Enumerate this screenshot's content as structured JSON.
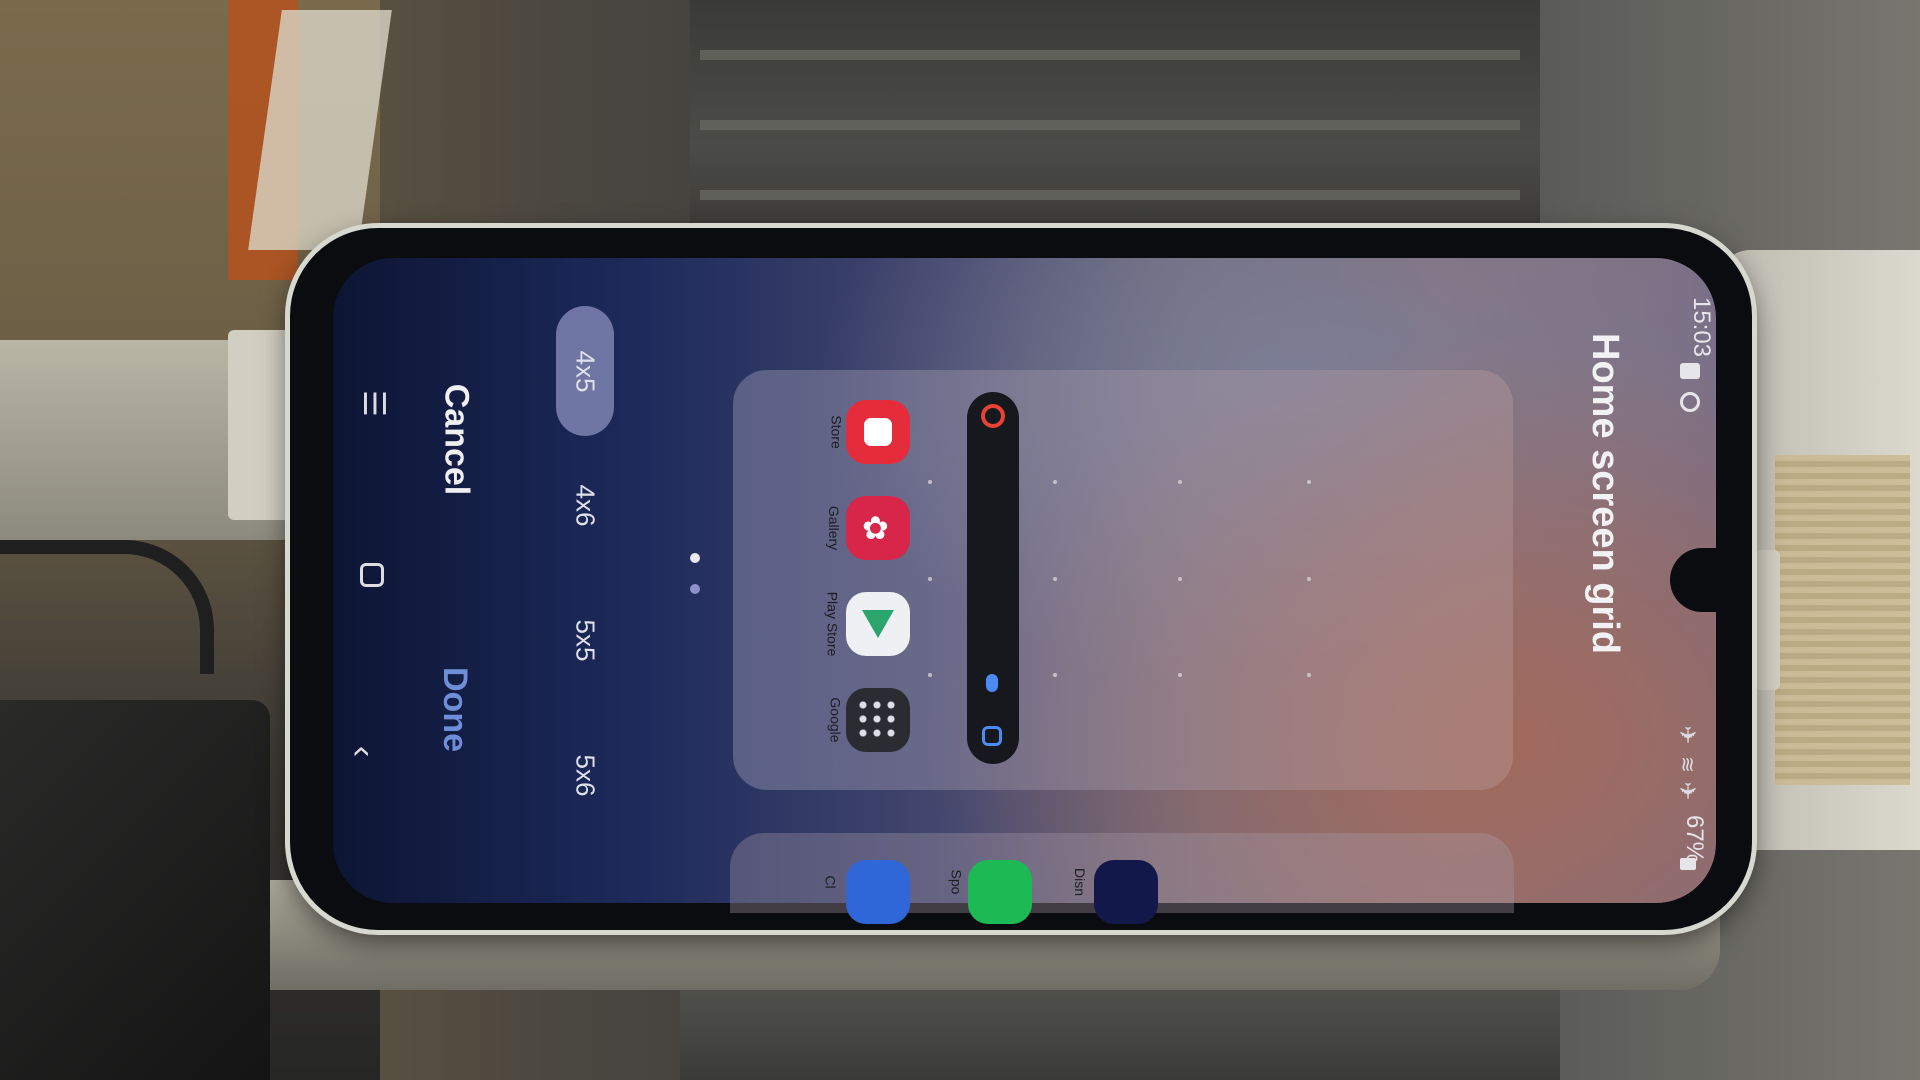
{
  "screen": {
    "title": "Home screen grid",
    "status_bar": {
      "time": "15:03",
      "battery": "67%"
    },
    "actions": {
      "cancel_label": "Cancel",
      "done_label": "Done"
    },
    "grid_options": [
      {
        "label": "4x5",
        "selected": true
      },
      {
        "label": "4x6",
        "selected": false
      },
      {
        "label": "5x5",
        "selected": false
      },
      {
        "label": "5x6",
        "selected": false
      }
    ],
    "preview": {
      "apps": [
        {
          "label": "Store",
          "icon": "galaxy-store-icon",
          "color": "#e52c3a"
        },
        {
          "label": "Gallery",
          "icon": "gallery-icon",
          "color": "#d8254a"
        },
        {
          "label": "Play Store",
          "icon": "play-store-icon",
          "color": "#eef0f4"
        },
        {
          "label": "Google",
          "icon": "google-folder-icon",
          "color": "#2a2c31"
        }
      ],
      "search_widget": {
        "icons": [
          "google-g-icon",
          "microphone-icon",
          "lens-icon"
        ]
      },
      "next_page_apps": [
        {
          "label": "Cl",
          "icon": "clock-icon",
          "color": "#2f66d8"
        },
        {
          "label": "Spo",
          "icon": "spotify-icon",
          "color": "#1db954"
        },
        {
          "label": "Disn",
          "icon": "disney-plus-icon",
          "color": "#13184a"
        }
      ]
    },
    "nav_bar": {
      "icons": [
        "recents-icon",
        "home-icon",
        "back-icon"
      ]
    }
  }
}
